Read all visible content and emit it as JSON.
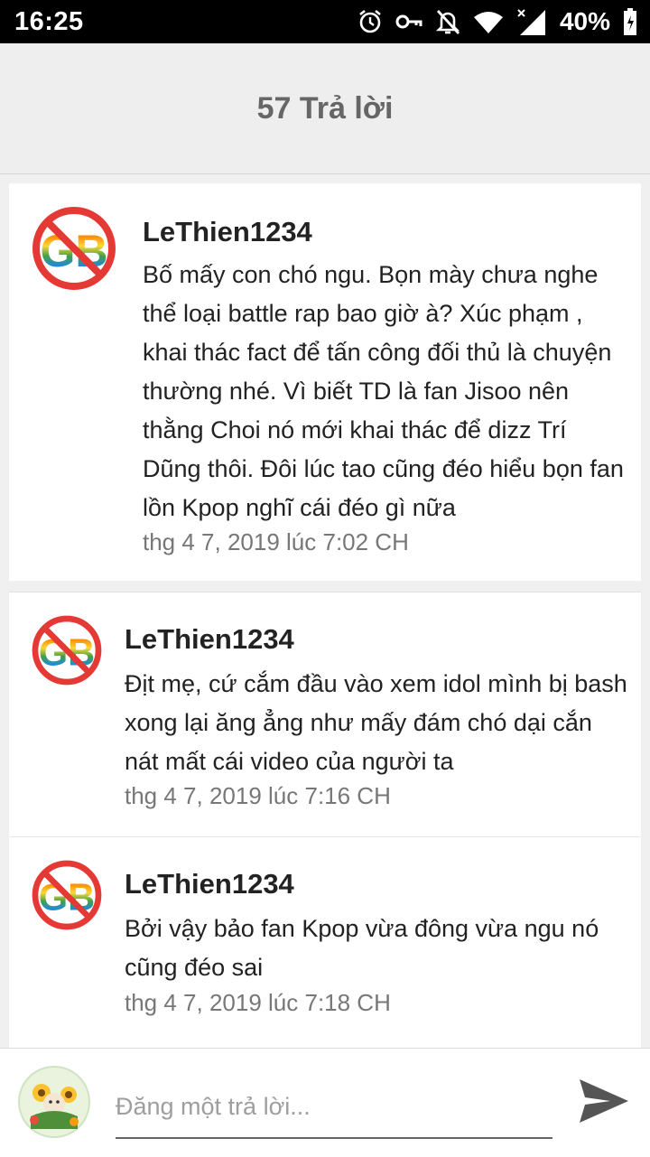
{
  "status_bar": {
    "time": "16:25",
    "battery": "40%",
    "icons": [
      "alarm-icon",
      "key-icon",
      "notifications-off-icon",
      "wifi-icon",
      "signal-icon",
      "battery-icon"
    ]
  },
  "header": {
    "title": "57 Trả lời"
  },
  "comments": [
    {
      "user": "LeThien1234",
      "text": "Bố mấy con chó ngu. Bọn mày chưa nghe thể loại battle rap bao giờ à? Xúc phạm , khai thác fact để tấn công đối thủ là chuyện thường nhé. Vì biết TD là fan Jisoo nên thằng Choi nó mới khai thác để dizz Trí Dũng thôi. Đôi lúc tao cũng đéo hiểu bọn fan lồn Kpop nghĩ cái đéo gì nữa",
      "time": "thg 4 7, 2019 lúc 7:02 CH"
    },
    {
      "user": "LeThien1234",
      "text": "Địt mẹ, cứ cắm đầu vào xem idol mình bị bash xong lại ăng ẳng như mấy đám chó dại cắn nát mất cái video của người ta",
      "time": "thg 4 7, 2019 lúc 7:16 CH"
    },
    {
      "user": "LeThien1234",
      "text": "Bởi vậy bảo fan Kpop vừa đông vừa ngu nó cũng đéo sai",
      "time": "thg 4 7, 2019 lúc 7:18 CH"
    }
  ],
  "composer": {
    "placeholder": "Đăng một trả lời..."
  },
  "colors": {
    "header_bg": "#eeeeee",
    "header_text": "#666666",
    "timestamp": "#777777",
    "send": "#555555"
  }
}
